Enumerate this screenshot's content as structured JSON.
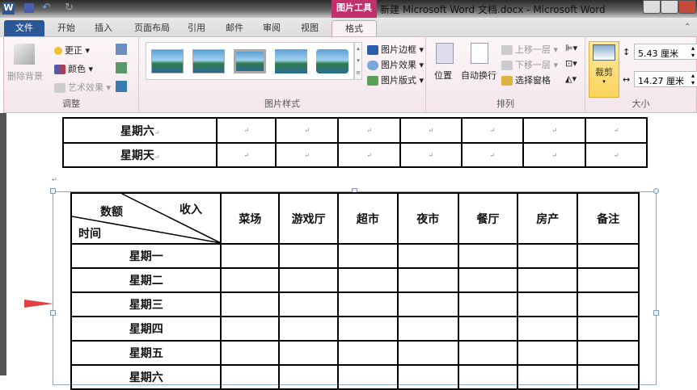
{
  "window": {
    "title": "新建 Microsoft Word 文档.docx - Microsoft Word",
    "context_tab": "图片工具"
  },
  "tabs": [
    "文件",
    "开始",
    "插入",
    "页面布局",
    "引用",
    "邮件",
    "审阅",
    "视图",
    "格式"
  ],
  "ribbon": {
    "adjust": {
      "label": "调整",
      "remove_bg": "删除背景",
      "corrections": "更正",
      "color": "颜色",
      "artistic": "艺术效果"
    },
    "styles": {
      "label": "图片样式",
      "border": "图片边框",
      "effects": "图片效果",
      "layout": "图片版式"
    },
    "arrange": {
      "label": "排列",
      "position": "位置",
      "wrap": "自动换行",
      "forward": "上移一层",
      "backward": "下移一层",
      "selection_pane": "选择窗格"
    },
    "size": {
      "label": "大小",
      "crop": "裁剪",
      "height": "5.43 厘米",
      "width": "14.27 厘米"
    }
  },
  "top_table": {
    "rows": [
      "星期六",
      "星期天"
    ]
  },
  "main_table": {
    "corner": {
      "top_right": "收入",
      "middle": "数额",
      "bottom_left": "时间"
    },
    "headers": [
      "菜场",
      "游戏厅",
      "超市",
      "夜市",
      "餐厅",
      "房产",
      "备注"
    ],
    "rows": [
      "星期一",
      "星期二",
      "星期三",
      "星期四",
      "星期五",
      "星期六"
    ]
  },
  "colors": {
    "accent": "#c2306c",
    "file_tab": "#2b5797",
    "crop_highlight": "#fbd96a",
    "arrow": "#e04040"
  }
}
